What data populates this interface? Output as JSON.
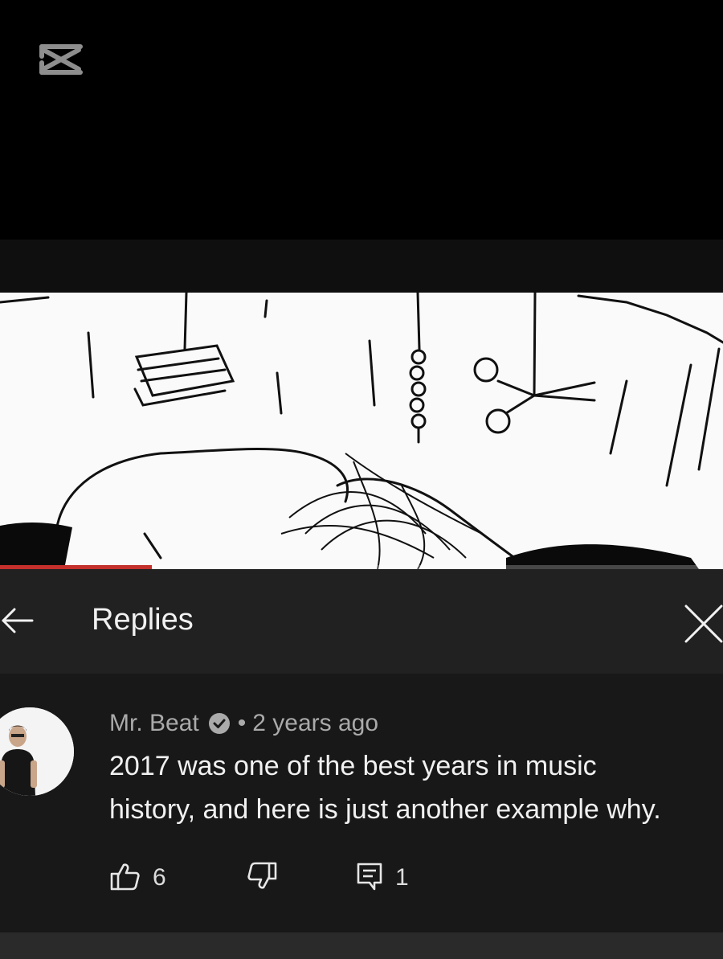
{
  "watermark": {
    "icon": "capcut-logo-icon"
  },
  "video": {
    "progress_fraction": 0.21
  },
  "panel": {
    "title": "Replies",
    "back_icon": "back-arrow-icon",
    "close_icon": "close-icon"
  },
  "comment": {
    "author": "Mr. Beat",
    "verified_icon": "verified-check-icon",
    "separator": "•",
    "time": "2 years ago",
    "text_lines": [
      "2017 was one of the best years in music",
      "history, and here is just another example why."
    ],
    "likes": "6",
    "replies": "1"
  },
  "colors": {
    "panel_header": "#212121",
    "comment_bg": "#181818",
    "progress": "#c4302b",
    "meta_text": "#aaaaaa"
  }
}
